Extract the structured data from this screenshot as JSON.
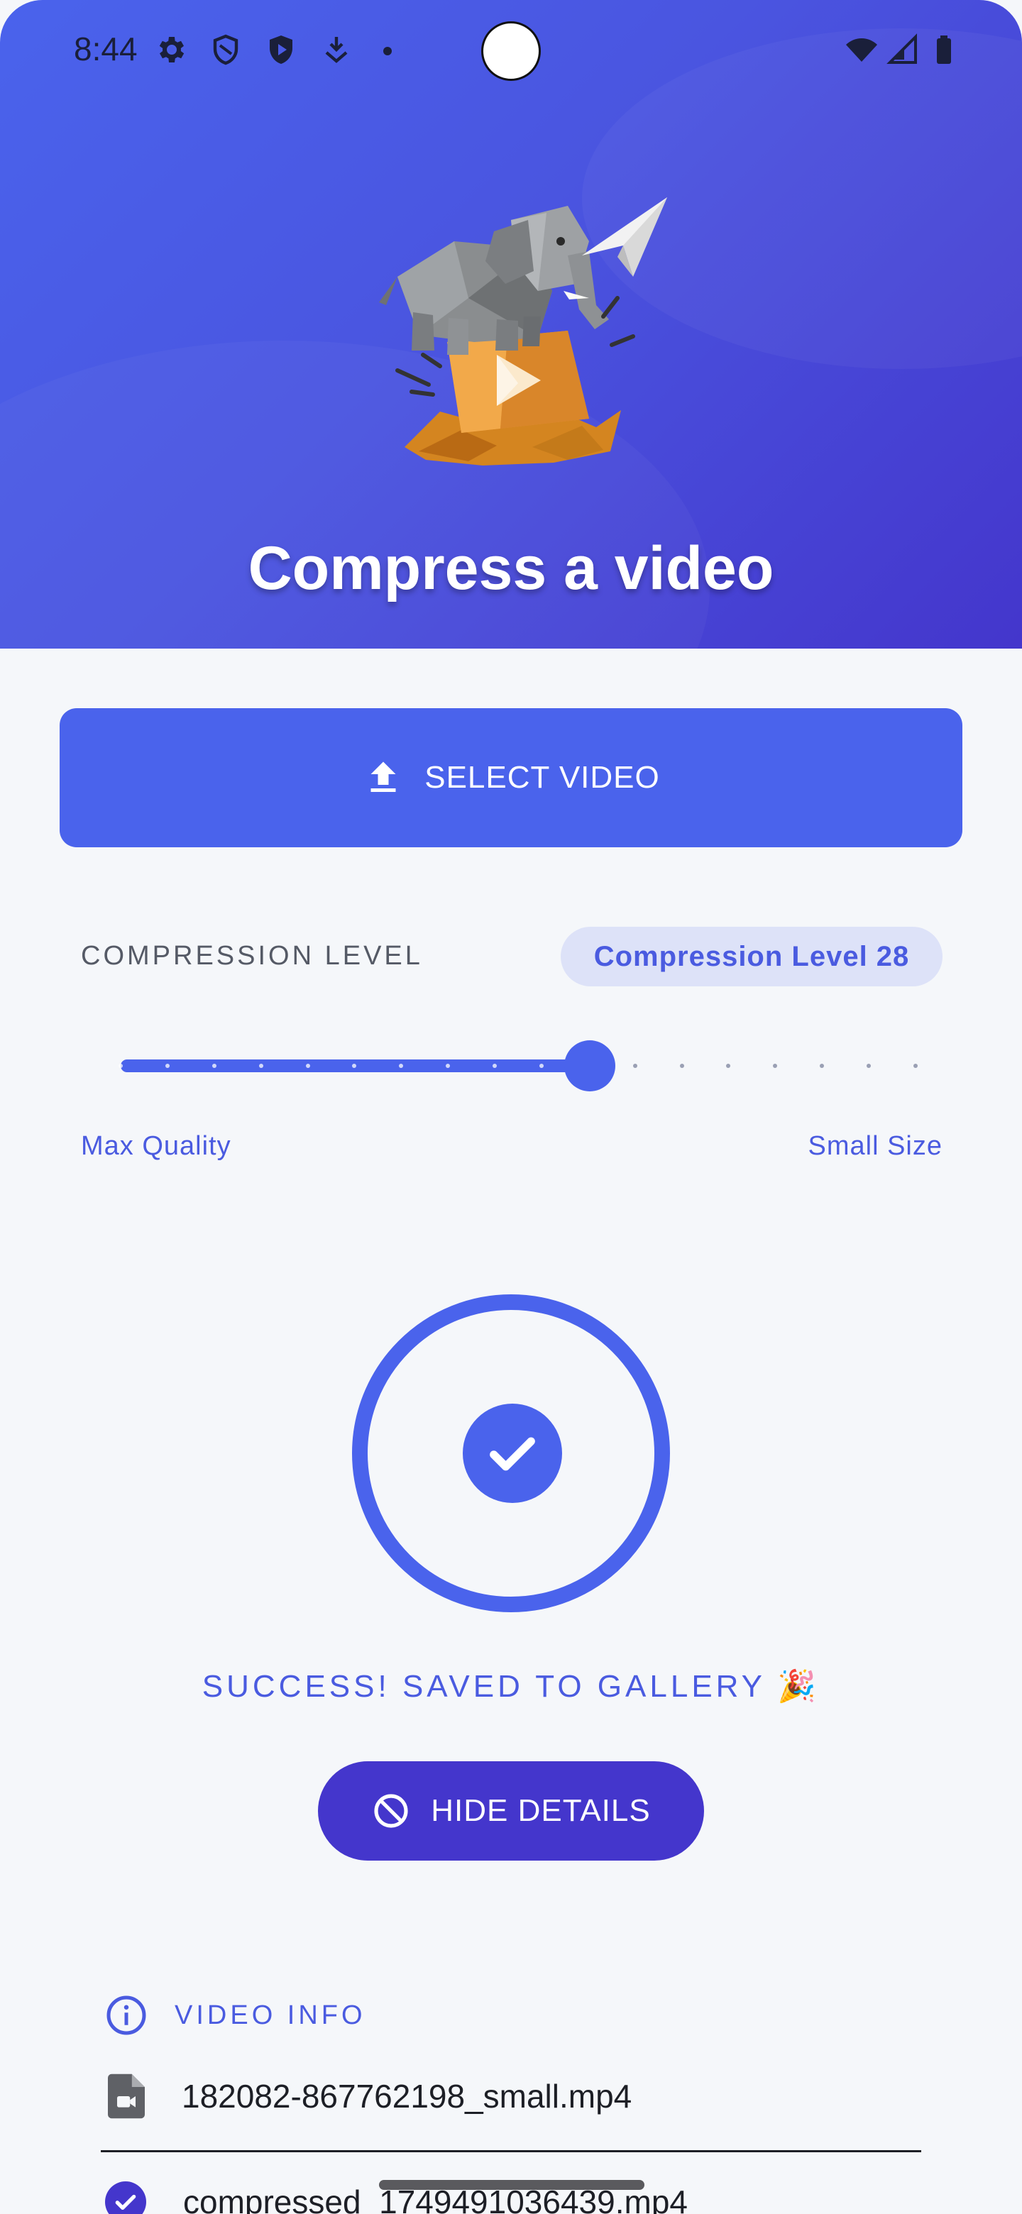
{
  "status_bar": {
    "time": "8:44",
    "left_icons": [
      "settings-icon",
      "shield-icon",
      "play-protect-icon",
      "download-icon"
    ],
    "right_icons": [
      "wifi-icon",
      "signal-icon",
      "battery-icon"
    ]
  },
  "header": {
    "title": "Compress a video",
    "illustration": "elephant-on-video-box-with-paper-plane"
  },
  "select_button": {
    "label": "SELECT VIDEO",
    "icon": "upload-icon"
  },
  "compression": {
    "section_label": "COMPRESSION LEVEL",
    "badge": "Compression Level 28",
    "slider_value_fraction": 0.59,
    "tick_count": 18,
    "min_label": "Max Quality",
    "max_label": "Small Size"
  },
  "result": {
    "status_icon": "check-circle-icon",
    "message": "SUCCESS! SAVED TO GALLERY 🎉",
    "toggle_label": "HIDE DETAILS",
    "toggle_icon": "hide-icon"
  },
  "video_info": {
    "heading": "VIDEO INFO",
    "source_file": "182082-867762198_small.mp4",
    "output_file": "compressed_1749491036439.mp4"
  },
  "colors": {
    "primary": "#4a63ec",
    "deep": "#4436cc",
    "badge_bg": "#dde2f8",
    "background": "#f5f7fa"
  }
}
